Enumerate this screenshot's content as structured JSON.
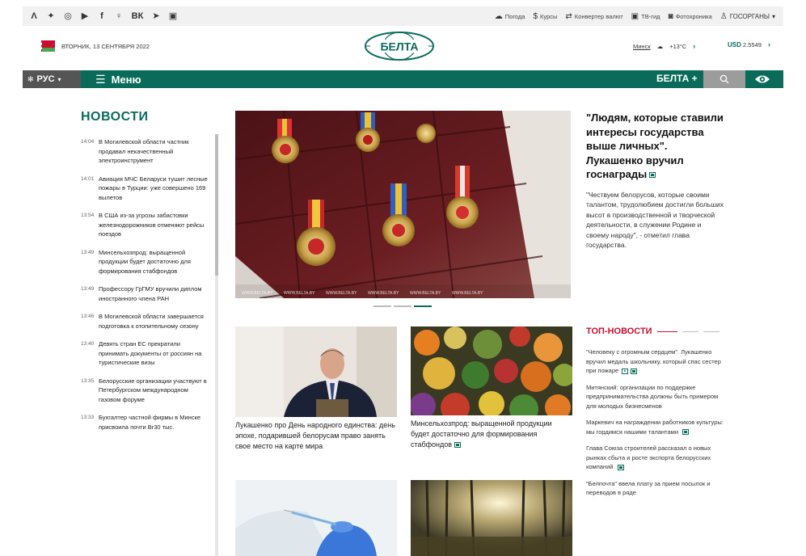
{
  "topbar": {
    "social": [
      "Λ",
      "✦",
      "◎",
      "▶",
      "f",
      "♀",
      "ВК",
      "➤",
      "▣"
    ],
    "social_names": [
      "rss-icon",
      "twitter-icon",
      "instagram-icon",
      "youtube-icon",
      "facebook-icon",
      "odnoklassniki-icon",
      "vk-icon",
      "telegram-icon",
      "app-icon"
    ],
    "utils": [
      {
        "label": "Погода",
        "icon": "weather-icon"
      },
      {
        "label": "Курсы",
        "icon": "currency-icon"
      },
      {
        "label": "Конвертер валют",
        "icon": "converter-icon"
      },
      {
        "label": "ТВ-гид",
        "icon": "tv-icon"
      },
      {
        "label": "Фотохроника",
        "icon": "photo-icon"
      }
    ],
    "gos": "ГОСОРГАНЫ"
  },
  "header": {
    "date": "ВТОРНИК, 13 СЕНТЯБРЯ 2022",
    "logo_text": "БЕЛТА",
    "city": "Минск",
    "temperature": "+13°C",
    "usd_label": "USD",
    "usd_value": "2.5549"
  },
  "nav": {
    "lang": "РУС",
    "menu": "Меню",
    "belta_plus": "БЕЛТА +"
  },
  "news": {
    "title": "НОВОСТИ",
    "items": [
      {
        "time": "14:04",
        "text": "В Могилевской области частник продавал некачественный электроинструмент"
      },
      {
        "time": "14:01",
        "text": "Авиация МЧС Беларуси тушит лесные пожары в Турции: уже совершено 169 вылетов"
      },
      {
        "time": "13:54",
        "text": "В США из-за угрозы забастовки железнодорожников отменяют рейсы поездов"
      },
      {
        "time": "13:49",
        "text": "Минсельхозпрод: выращенной продукции будет достаточно для формирования стабфондов"
      },
      {
        "time": "13:49",
        "text": "Профессору ГрГМУ вручили диплом иностранного члена РАН"
      },
      {
        "time": "13:46",
        "text": "В Могилевской области завершается подготовка к отопительному сезону"
      },
      {
        "time": "13:40",
        "text": "Девять стран ЕС прекратили принимать документы от россиян на туристические визы"
      },
      {
        "time": "13:35",
        "text": "Белорусские организации участвуют в Петербургском международном газовом форуме"
      },
      {
        "time": "13:33",
        "text": "Бухгалтер частной фирмы в Минске присвоила почти Br30 тыс."
      }
    ]
  },
  "lead": {
    "title": "\"Людям, которые ставили интересы государства выше личных\". Лукашенко вручил госнаграды",
    "text": "\"Чествуем белорусов, которые своими талантом, трудолюбием достигли больших высот в производственной и творческой деятельности, в служении Родине и своему народу\", - отметил глава государства.",
    "watermark": "WWW.BELTA.BY"
  },
  "cards": [
    {
      "caption": "Лукашенко про День народного единства: день эпохе, подарившей белорусам право занять свое место на карте мира"
    },
    {
      "caption": "Минсельхозпрод: выращенной продукции будет достаточно для формирования стабфондов"
    }
  ],
  "top_news": {
    "title": "ТОП-НОВОСТИ",
    "items": [
      "\"Человеку с огромным сердцем\". Лукашенко вручил медаль школьнику, который спас сестер при пожаре",
      "Митянский: организации по поддержке предпринимательства должны быть примером для молодых бизнесменов",
      "Маркевич на награждении работников культуры: мы гордимся нашими талантами",
      "Глава Союза строителей рассказал о новых рынках сбыта и росте экспорта белорусских компаний",
      "\"Белпочта\" ввела плату за прием посылок и переводов в ряде"
    ]
  },
  "colors": {
    "brand": "#0a6b5b",
    "accent": "#c8102e"
  }
}
